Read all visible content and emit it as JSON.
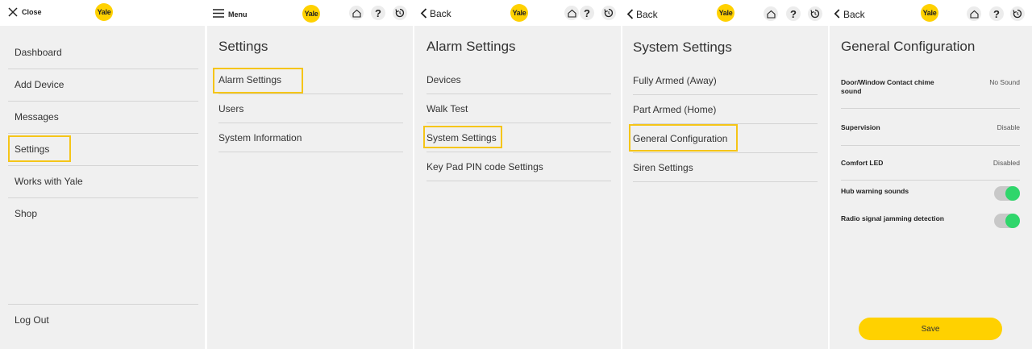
{
  "menu_panel": {
    "close_label": "Close",
    "logo": "Yale",
    "items": [
      "Dashboard",
      "Add Device",
      "Messages",
      "Settings",
      "Works with Yale",
      "Shop"
    ],
    "logout_label": "Log Out"
  },
  "settings_panel": {
    "menu_label": "Menu",
    "logo": "Yale",
    "title": "Settings",
    "items": [
      "Alarm Settings",
      "Users",
      "System Information"
    ]
  },
  "alarm_panel": {
    "back_label": "Back",
    "logo": "Yale",
    "title": "Alarm Settings",
    "items": [
      "Devices",
      "Walk Test",
      "System Settings",
      "Key Pad PIN code Settings"
    ]
  },
  "system_panel": {
    "back_label": "Back",
    "logo": "Yale",
    "title": "System Settings",
    "items": [
      "Fully Armed (Away)",
      "Part Armed (Home)",
      "General Configuration",
      "Siren Settings"
    ]
  },
  "general_panel": {
    "back_label": "Back",
    "logo": "Yale",
    "title": "General Configuration",
    "rows": [
      {
        "label": "Door/Window Contact chime sound",
        "value": "No Sound"
      },
      {
        "label": "Supervision",
        "value": "Disable"
      },
      {
        "label": "Comfort LED",
        "value": "Disabled"
      },
      {
        "label": "Hub warning sounds",
        "toggle": "on"
      },
      {
        "label": "Radio signal jamming detection",
        "toggle": "on"
      }
    ],
    "save_label": "Save"
  },
  "colors": {
    "brand_yellow": "#ffd100",
    "highlight": "#f5c518",
    "toggle_on": "#2fd66b",
    "panel_bg": "#f0f0f0"
  }
}
